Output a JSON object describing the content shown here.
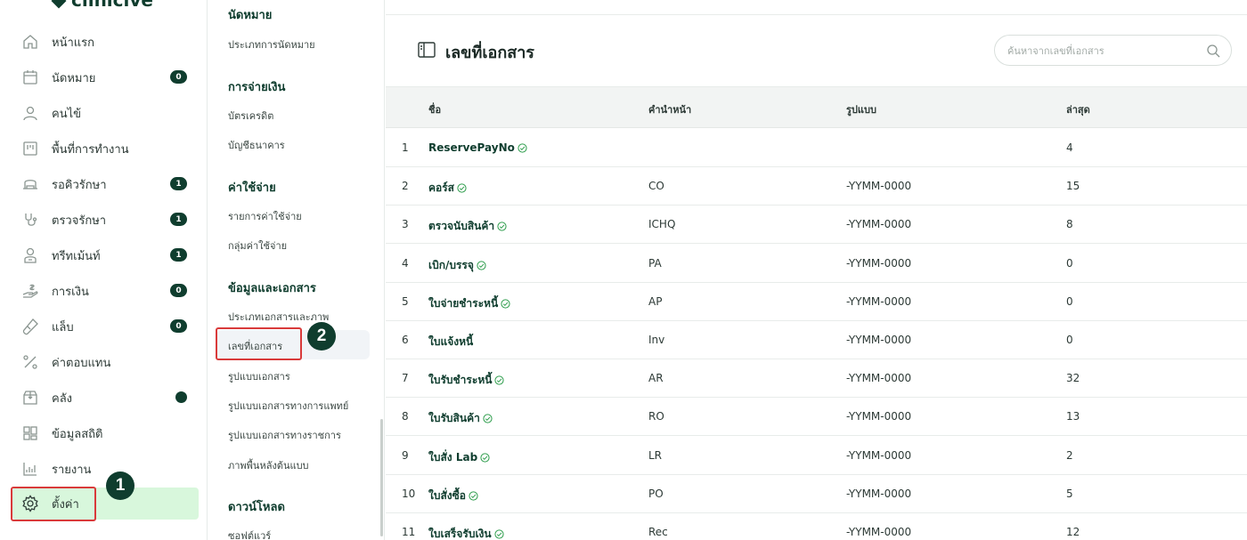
{
  "app": {
    "logo_text": "clinicive"
  },
  "sidebar": {
    "items": [
      {
        "label": "หน้าแรก",
        "icon": "home-icon",
        "badge": ""
      },
      {
        "label": "นัดหมาย",
        "icon": "calendar-icon",
        "badge": "0"
      },
      {
        "label": "คนไข้",
        "icon": "user-icon",
        "badge": ""
      },
      {
        "label": "พื้นที่การทำงาน",
        "icon": "workspace-icon",
        "badge": ""
      },
      {
        "label": "รอคิวรักษา",
        "icon": "queue-icon",
        "badge": "1"
      },
      {
        "label": "ตรวจรักษา",
        "icon": "stethoscope-icon",
        "badge": "1"
      },
      {
        "label": "ทรีทเม้นท์",
        "icon": "treatment-icon",
        "badge": "1"
      },
      {
        "label": "การเงิน",
        "icon": "money-icon",
        "badge": "0"
      },
      {
        "label": "แล็บ",
        "icon": "lab-icon",
        "badge": "0"
      },
      {
        "label": "ค่าตอบแทน",
        "icon": "percent-icon",
        "badge": ""
      },
      {
        "label": "คลัง",
        "icon": "inventory-icon",
        "badge": ""
      },
      {
        "label": "ข้อมูลสถิติ",
        "icon": "statistics-icon",
        "badge": ""
      },
      {
        "label": "รายงาน",
        "icon": "report-icon",
        "badge": ""
      },
      {
        "label": "ตั้งค่า",
        "icon": "gear-icon",
        "badge": ""
      }
    ]
  },
  "submenu": {
    "top_cut_label": "นัดหมาย",
    "appointment_type": "ประเภทการนัดหมาย",
    "payment_head": "การจ่ายเงิน",
    "credit_card": "บัตรเครดิต",
    "bank_account": "บัญชีธนาคาร",
    "expense_head": "ค่าใช้จ่าย",
    "expense_list": "รายการค่าใช้จ่าย",
    "expense_group": "กลุ่มค่าใช้จ่าย",
    "docs_head": "ข้อมูลและเอกสาร",
    "doc_image_type": "ประเภทเอกสารและภาพ",
    "doc_number": "เลขที่เอกสาร",
    "doc_format": "รูปแบบเอกสาร",
    "doc_format_medical": "รูปแบบเอกสารทางการแพทย์",
    "doc_format_gov": "รูปแบบเอกสารทางราชการ",
    "bg_template": "ภาพพื้นหลังต้นแบบ",
    "download_head": "ดาวน์โหลด",
    "software": "ซอฟต์แวร์"
  },
  "main": {
    "title": "เลขที่เอกสาร",
    "search_placeholder": "ค้นหาจากเลขที่เอกสาร",
    "columns": {
      "name": "ชื่อ",
      "prefix": "คำนำหน้า",
      "format": "รูปแบบ",
      "latest": "ล่าสุด"
    },
    "rows": [
      {
        "no": "1",
        "name": "ReservePayNo",
        "prefix": "",
        "format": "",
        "latest": "4"
      },
      {
        "no": "2",
        "name": "คอร์ส",
        "prefix": "CO",
        "format": "-YYMM-0000",
        "latest": "15"
      },
      {
        "no": "3",
        "name": "ตรวจนับสินค้า",
        "prefix": "ICHQ",
        "format": "-YYMM-0000",
        "latest": "8"
      },
      {
        "no": "4",
        "name": "เบิก/บรรจุ",
        "prefix": "PA",
        "format": "-YYMM-0000",
        "latest": "0"
      },
      {
        "no": "5",
        "name": "ใบจ่ายชำระหนี้",
        "prefix": "AP",
        "format": "-YYMM-0000",
        "latest": "0"
      },
      {
        "no": "6",
        "name": "ใบแจ้งหนี้",
        "prefix": "Inv",
        "format": "-YYMM-0000",
        "latest": "0"
      },
      {
        "no": "7",
        "name": "ใบรับชำระหนี้",
        "prefix": "AR",
        "format": "-YYMM-0000",
        "latest": "32"
      },
      {
        "no": "8",
        "name": "ใบรับสินค้า",
        "prefix": "RO",
        "format": "-YYMM-0000",
        "latest": "13"
      },
      {
        "no": "9",
        "name": "ใบสั่ง Lab",
        "prefix": "LR",
        "format": "-YYMM-0000",
        "latest": "2"
      },
      {
        "no": "10",
        "name": "ใบสั่งซื้อ",
        "prefix": "PO",
        "format": "-YYMM-0000",
        "latest": "5"
      },
      {
        "no": "11",
        "name": "ใบเสร็จรับเงิน",
        "prefix": "Rec",
        "format": "-YYMM-0000",
        "latest": "12"
      }
    ]
  },
  "annotations": {
    "step1": "1",
    "step2": "2"
  },
  "colors": {
    "brand": "#0f3d2e",
    "active_bg": "#d8f7dc",
    "highlight": "#d93a3a",
    "check": "#2e9d4c"
  }
}
